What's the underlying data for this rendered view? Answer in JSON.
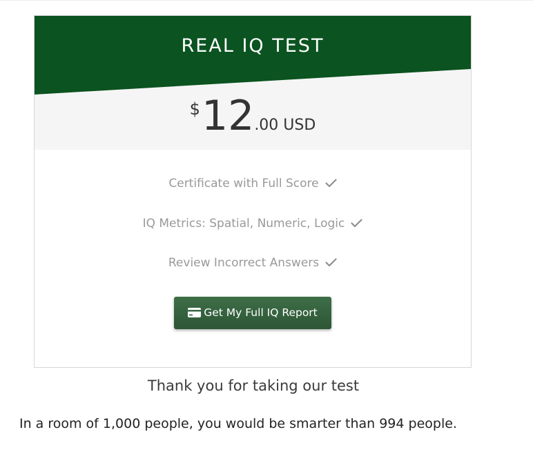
{
  "pricing_card": {
    "title": "REAL IQ TEST",
    "price": {
      "currency_symbol": "$",
      "amount": "12",
      "cents_currency": ".00 USD"
    },
    "features": [
      "Certificate with Full Score",
      "IQ Metrics: Spatial, Numeric, Logic",
      "Review Incorrect Answers"
    ],
    "feature_icon": "check-icon",
    "cta": {
      "label": "Get My Full IQ Report",
      "icon": "credit-card-icon"
    }
  },
  "thank_you": "Thank you for taking our test",
  "result_text": "In a room of 1,000 people, you would be smarter than 994 people.",
  "colors": {
    "header_green": "#0b5320",
    "button_green": "#35603e",
    "price_band": "#f5f5f5",
    "feature_text": "#999999"
  }
}
